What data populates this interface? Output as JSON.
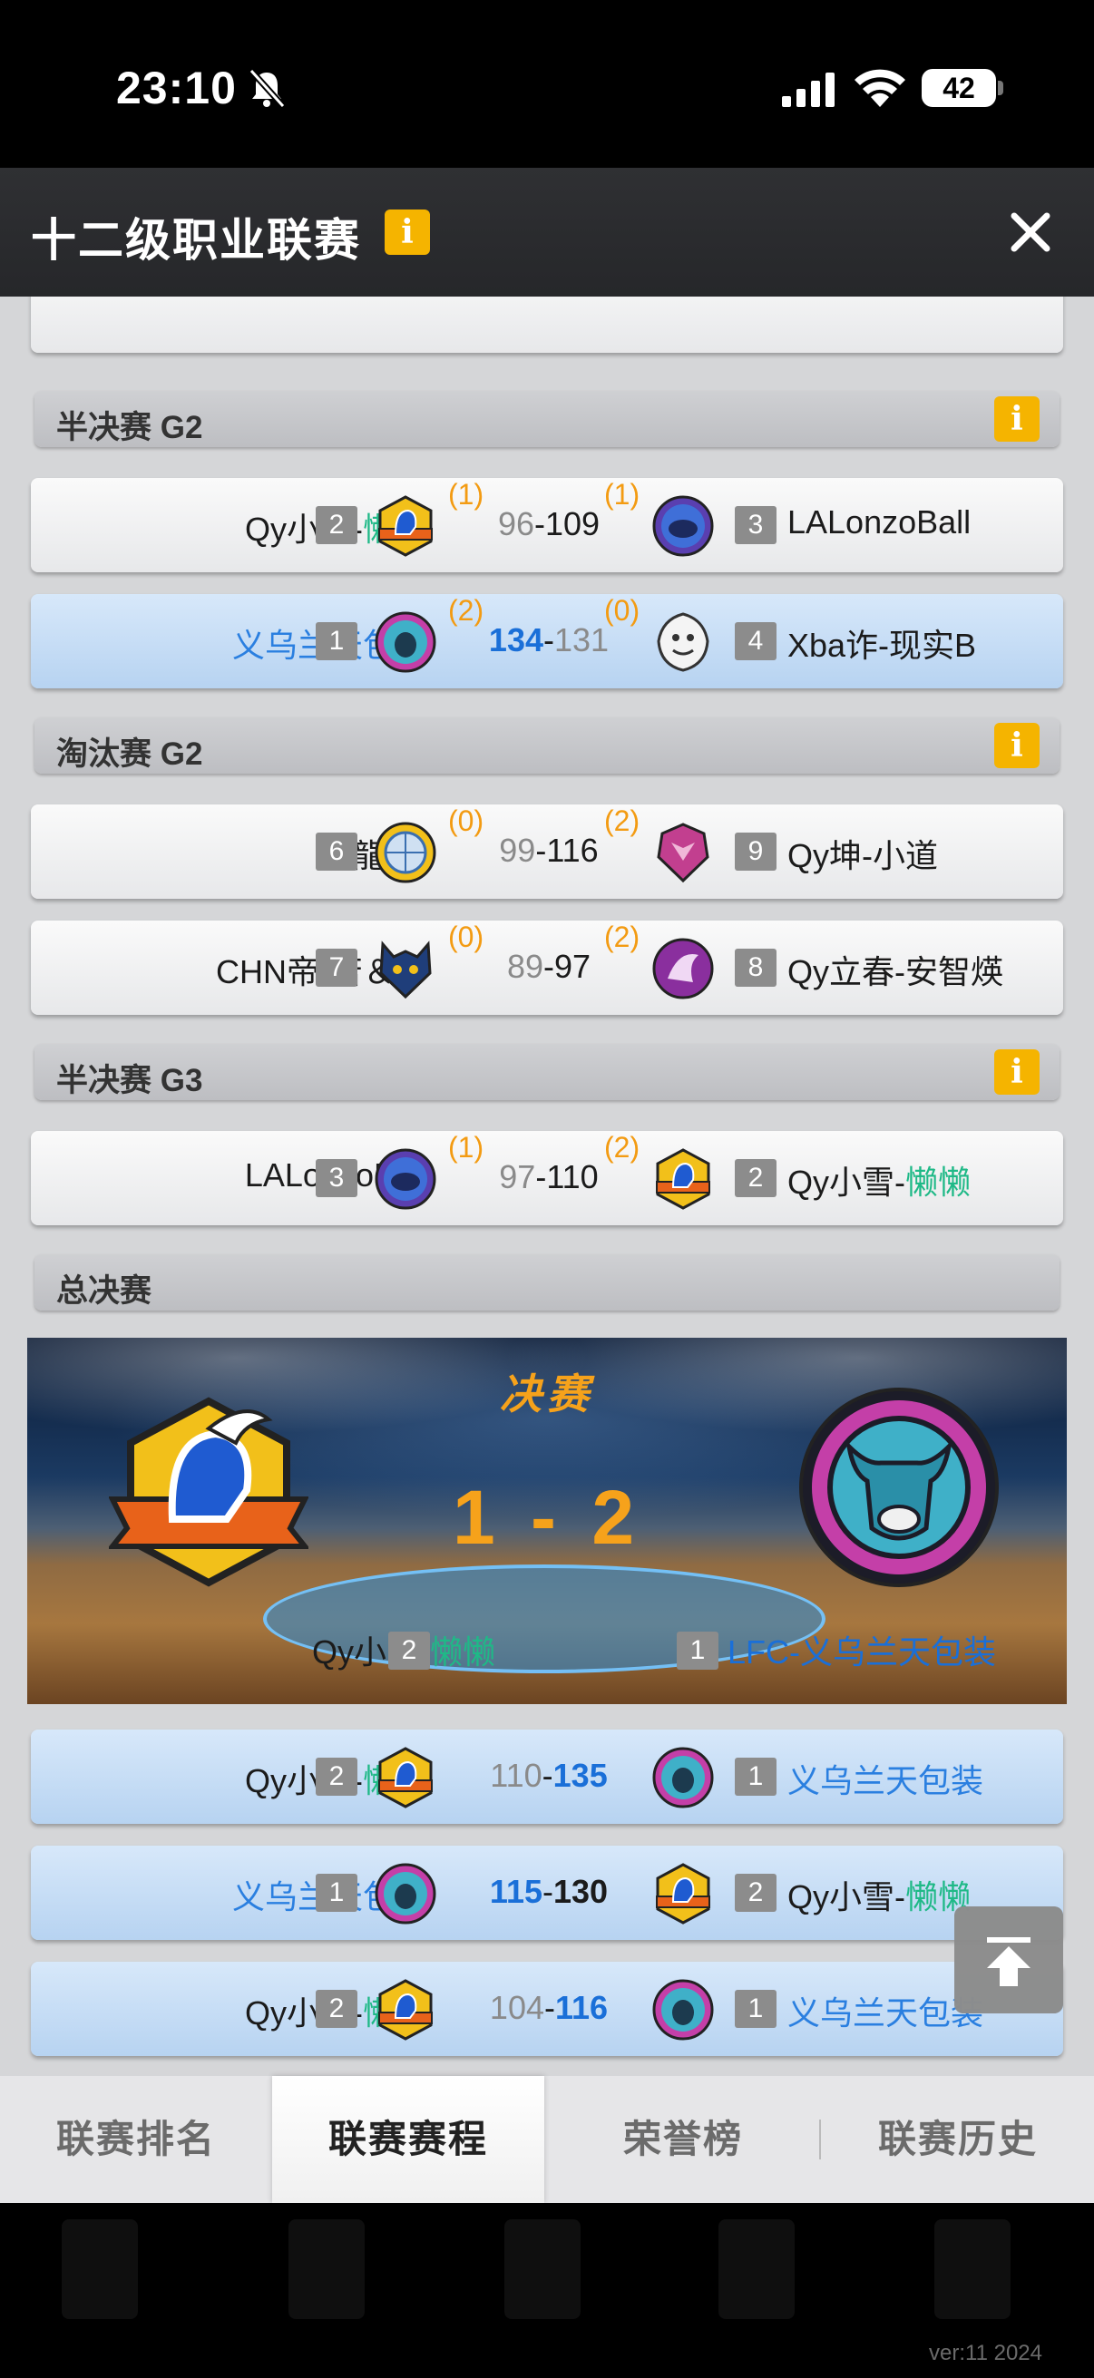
{
  "status": {
    "time": "23:10",
    "battery": "42"
  },
  "header": {
    "title": "十二级职业联赛"
  },
  "colors": {
    "accent_orange": "#f39b12",
    "winner_blue": "#1a6fd8",
    "name_green": "#1fb987",
    "info_yellow": "#f5b400"
  },
  "sections": [
    {
      "title": "半决赛 G2"
    },
    {
      "title": "淘汰赛 G2"
    },
    {
      "title": "半决赛 G3"
    },
    {
      "title": "总决赛"
    }
  ],
  "matches": [
    {
      "left_name": "Qy小雪-",
      "left_name_hl": "懒懒",
      "left_seed": "2",
      "left_sub": "(1)",
      "left_score": "96",
      "dash": "-",
      "right_score": "109",
      "right_sub": "(1)",
      "right_seed": "3",
      "right_name": "LALonzoBall",
      "left_logo": "knight-logo-icon",
      "right_logo": "rhino-logo-icon"
    },
    {
      "left_name": "义乌兰天包装",
      "left_seed": "1",
      "left_sub": "(2)",
      "left_score": "134",
      "dash": "-",
      "right_score": "131",
      "right_sub": "(0)",
      "right_seed": "4",
      "right_name": "Xba诈-现实B",
      "left_logo": "bison-logo-icon",
      "right_logo": "yeti-logo-icon"
    },
    {
      "left_name": "鳳龍-明",
      "left_seed": "6",
      "left_sub": "(0)",
      "left_score": "99",
      "dash": "-",
      "right_score": "116",
      "right_sub": "(2)",
      "right_seed": "9",
      "right_name": "Qy坤-小道",
      "left_logo": "basketball-logo-icon",
      "right_logo": "dragon-logo-icon"
    },
    {
      "left_name": "CHN帝-苦＆荞",
      "left_seed": "7",
      "left_sub": "(0)",
      "left_score": "89",
      "dash": "-",
      "right_score": "97",
      "right_sub": "(2)",
      "right_seed": "8",
      "right_name": "Qy立春-安智煐",
      "left_logo": "wolf-logo-icon",
      "right_logo": "bird-logo-icon"
    },
    {
      "left_name": "LALonzoBall",
      "left_seed": "3",
      "left_sub": "(1)",
      "left_score": "97",
      "dash": "-",
      "right_score": "110",
      "right_sub": "(2)",
      "right_seed": "2",
      "right_name": "Qy小雪-",
      "right_name_hl": "懒懒",
      "left_logo": "rhino-logo-icon",
      "right_logo": "knight-logo-icon"
    }
  ],
  "finals": {
    "title": "决赛",
    "score": "1 - 2",
    "left_name": "Qy小雪-",
    "left_name_hl": "懒懒",
    "left_seed": "2",
    "right_seed": "1",
    "right_name": "LFC-义乌兰天包装"
  },
  "final_games": [
    {
      "left_name": "Qy小雪-",
      "left_name_hl": "懒懒",
      "left_seed": "2",
      "left_score": "110",
      "dash": "-",
      "right_score": "135",
      "right_seed": "1",
      "right_name": "义乌兰天包装"
    },
    {
      "left_name": "义乌兰天包装",
      "left_seed": "1",
      "left_score": "115",
      "dash": "-",
      "right_score": "130",
      "right_seed": "2",
      "right_name": "Qy小雪-",
      "right_name_hl": "懒懒"
    },
    {
      "left_name": "Qy小雪-",
      "left_name_hl": "懒懒",
      "left_seed": "2",
      "left_score": "104",
      "dash": "-",
      "right_score": "116",
      "right_seed": "1",
      "right_name": "义乌兰天包装"
    }
  ],
  "tabs": [
    {
      "label": "联赛排名"
    },
    {
      "label": "联赛赛程",
      "active": true
    },
    {
      "label": "荣誉榜"
    },
    {
      "label": "联赛历史"
    }
  ],
  "version": "ver:11  2024"
}
